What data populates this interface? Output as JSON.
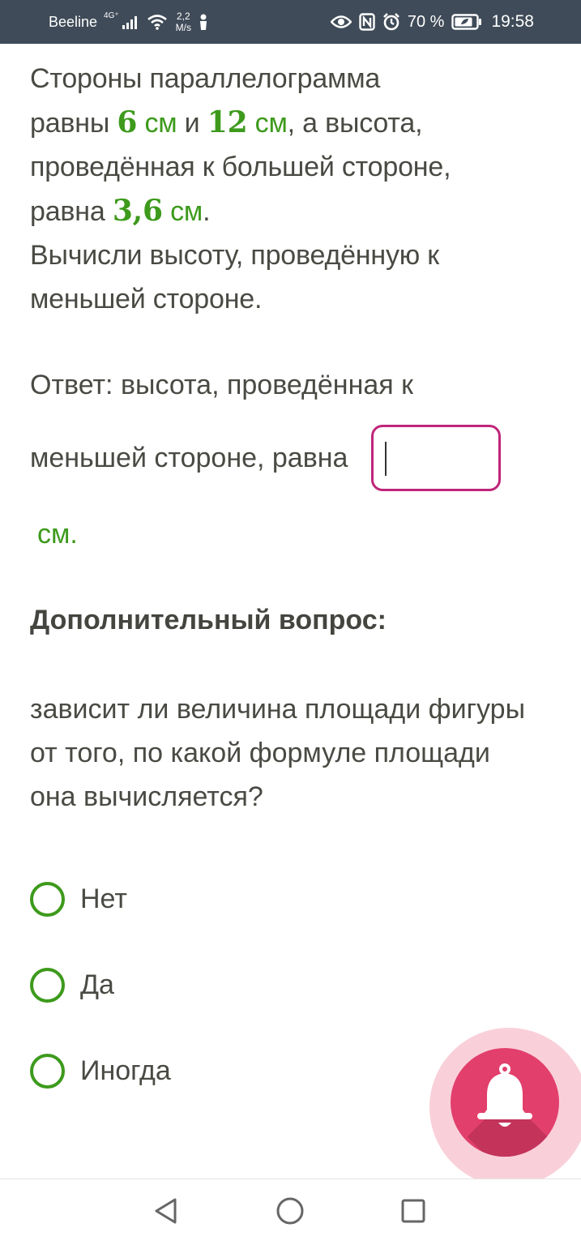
{
  "status_bar": {
    "carrier": "Beeline",
    "network_type": "4G⁺",
    "speed_value": "2,2",
    "speed_unit": "M/s",
    "battery_percent": "70 %",
    "time": "19:58",
    "icons": [
      "signal-icon",
      "wifi-icon",
      "notification-icon",
      "eye-icon",
      "nfc-icon",
      "alarm-icon",
      "battery-icon"
    ]
  },
  "problem": {
    "line1": "Стороны параллелограмма",
    "line2_pre": "равны ",
    "side1_value": "6",
    "unit1": " см",
    "line2_mid": " и ",
    "side2_value": "12",
    "unit2": " см",
    "line2_post": ", а высота,",
    "line3": "проведённая к большей стороне,",
    "line4_pre": "равна ",
    "height_value": "3,6",
    "unit3": " см",
    "line4_post": ".",
    "line5": "Вычисли высоту, проведённую к",
    "line6": "меньшей стороне."
  },
  "answer": {
    "line1": "Ответ: высота, проведённая к",
    "line2": "меньшей стороне, равна",
    "input_value": "",
    "unit": "см."
  },
  "extra": {
    "title": "Дополнительный вопрос:",
    "question_line1": "зависит ли величина площади фигуры",
    "question_line2": "от того, по какой формуле площади",
    "question_line3": "она вычисляется?",
    "options": [
      {
        "label": "Нет",
        "selected": false
      },
      {
        "label": "Да",
        "selected": false
      },
      {
        "label": "Иногда",
        "selected": false
      }
    ]
  },
  "fab": {
    "icon": "bell-icon"
  },
  "nav": {
    "icons": [
      "back-icon",
      "home-icon",
      "recents-icon"
    ]
  },
  "colors": {
    "accent_green": "#3d9a1c",
    "input_border": "#c0257a",
    "fab": "#e23f6c",
    "status_bar": "#3f4b58"
  }
}
